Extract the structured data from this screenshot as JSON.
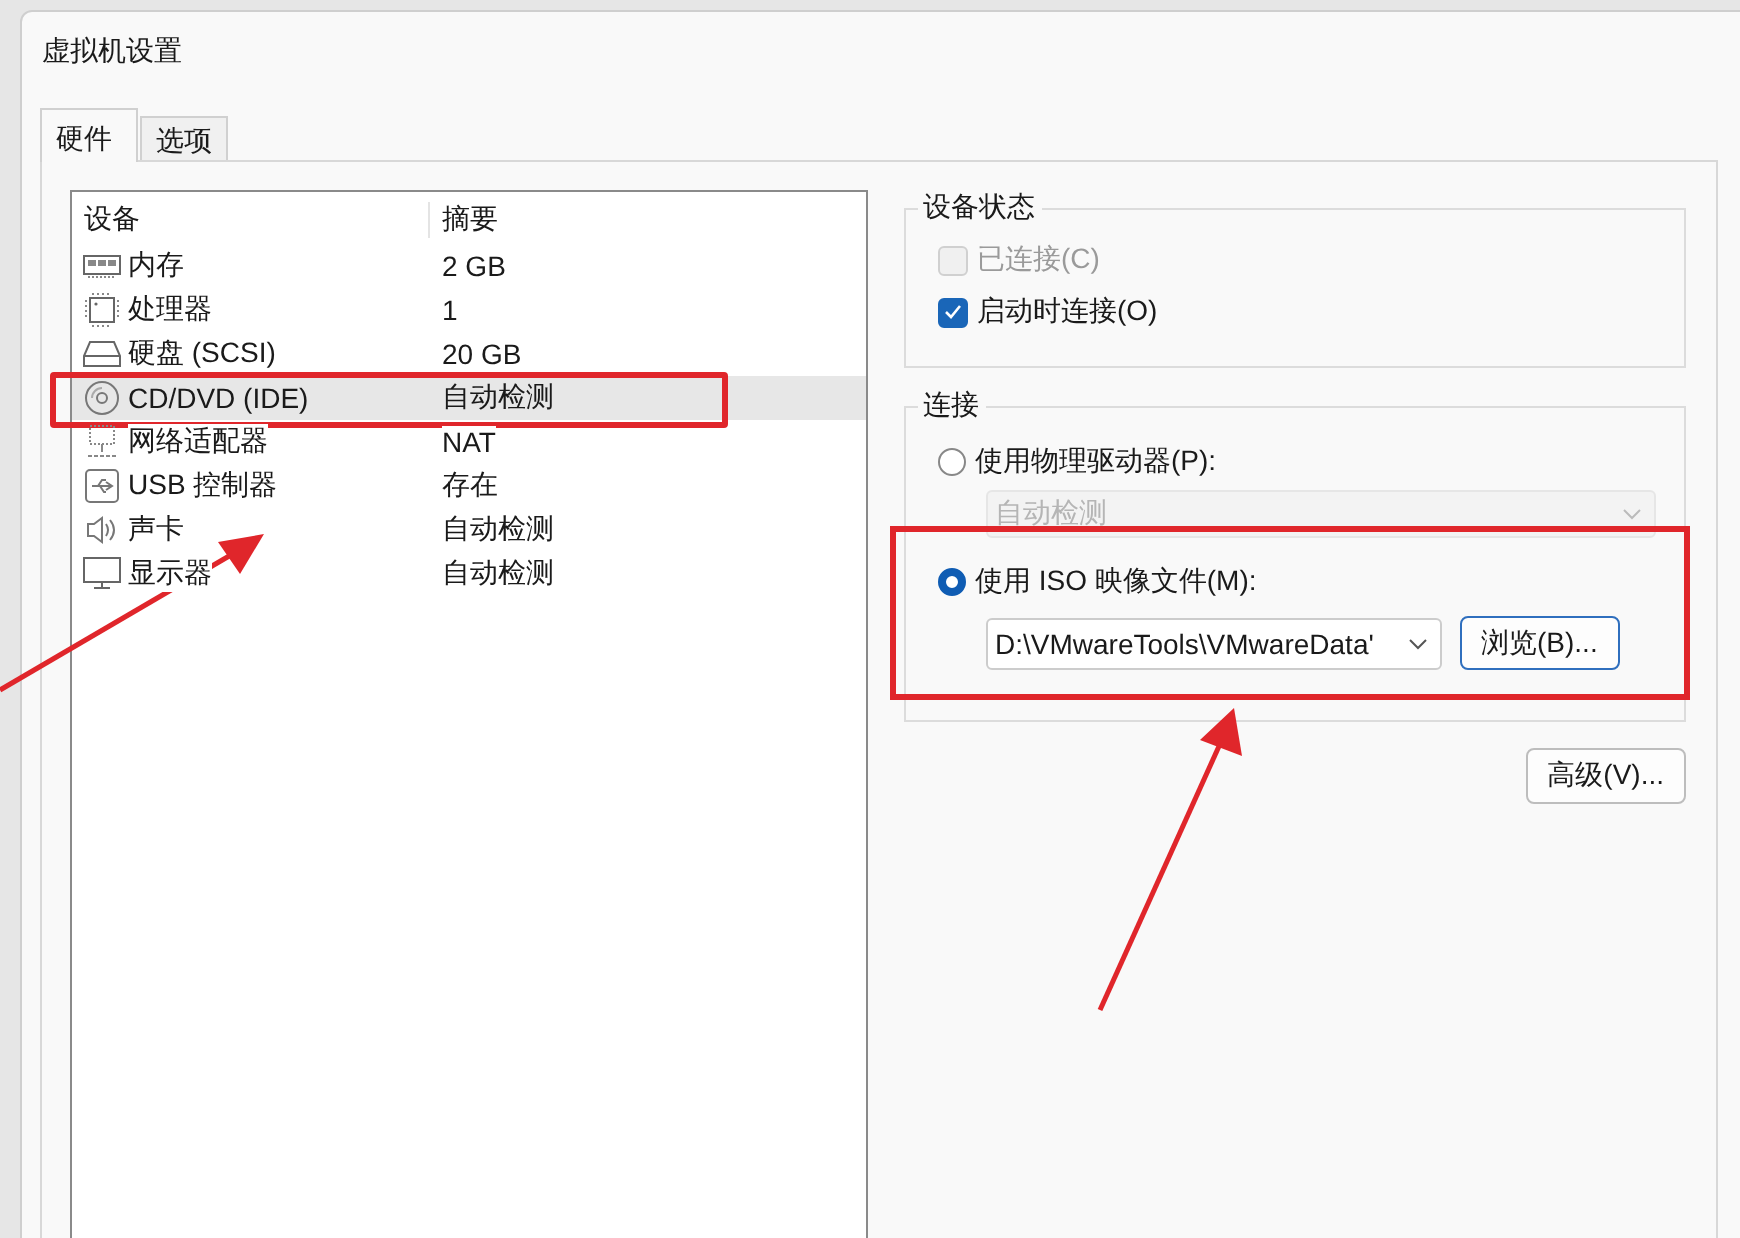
{
  "window": {
    "title": "虚拟机设置"
  },
  "tabs": [
    {
      "label": "硬件",
      "selected": true
    },
    {
      "label": "选项",
      "selected": false
    }
  ],
  "device_table": {
    "columns": [
      "设备",
      "摘要"
    ],
    "rows": [
      {
        "kind": "memory",
        "device": "内存",
        "summary": "2 GB",
        "selected": false,
        "highlighted": false
      },
      {
        "kind": "processor",
        "device": "处理器",
        "summary": "1",
        "selected": false,
        "highlighted": false
      },
      {
        "kind": "disk",
        "device": "硬盘 (SCSI)",
        "summary": "20 GB",
        "selected": false,
        "highlighted": false
      },
      {
        "kind": "cdrom",
        "device": "CD/DVD (IDE)",
        "summary": "自动检测",
        "selected": true,
        "highlighted": true
      },
      {
        "kind": "network",
        "device": "网络适配器",
        "summary": "NAT",
        "selected": false,
        "highlighted": false
      },
      {
        "kind": "usb",
        "device": "USB 控制器",
        "summary": "存在",
        "selected": false,
        "highlighted": false
      },
      {
        "kind": "sound",
        "device": "声卡",
        "summary": "自动检测",
        "selected": false,
        "highlighted": false
      },
      {
        "kind": "display",
        "device": "显示器",
        "summary": "自动检测",
        "selected": false,
        "highlighted": false
      }
    ]
  },
  "device_status": {
    "title": "设备状态",
    "options": [
      {
        "label": "已连接(C)",
        "checked": false,
        "disabled": true
      },
      {
        "label": "启动时连接(O)",
        "checked": true,
        "disabled": false
      }
    ]
  },
  "connection": {
    "title": "连接",
    "options": [
      {
        "kind": "physical",
        "label": "使用物理驱动器(P):",
        "selected": false,
        "highlighted": false,
        "dropdown": {
          "value": "自动检测",
          "disabled": true
        }
      },
      {
        "kind": "iso",
        "label": "使用 ISO 映像文件(M):",
        "selected": true,
        "highlighted": true,
        "path": {
          "value": "D:\\VMwareTools\\VMwareData'"
        },
        "browse_button": "浏览(B)..."
      }
    ]
  },
  "advanced_button": "高级(V)..."
}
